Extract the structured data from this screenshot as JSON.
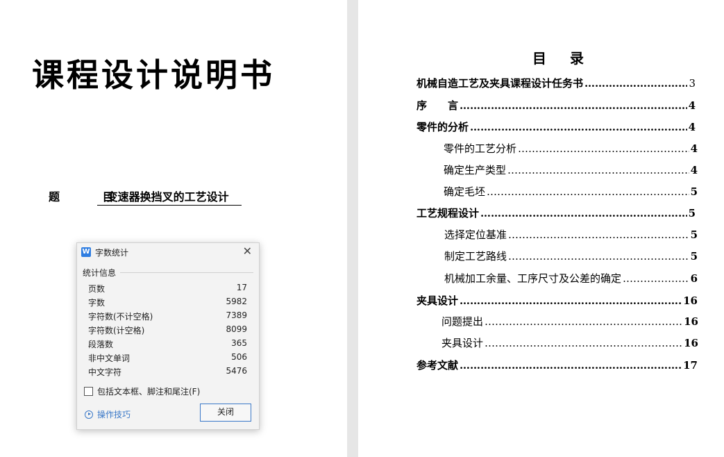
{
  "left_page": {
    "title": "课程设计说明书",
    "subject_label": "题 目",
    "subject_value": "变速器换挡叉的工艺设计"
  },
  "toc": {
    "title_a": "目",
    "title_b": "录",
    "entries": [
      {
        "text": "机械自造工艺及夹具课程设计任务书",
        "page": "3",
        "level": 1
      },
      {
        "text": "序　　言",
        "page": "4",
        "level": 1
      },
      {
        "text": "零件的分析",
        "page": "4",
        "level": 1
      },
      {
        "text": "零件的工艺分析",
        "page": "4",
        "level": 2
      },
      {
        "text": "确定生产类型",
        "page": "4",
        "level": 2
      },
      {
        "text": "确定毛坯",
        "page": "5",
        "level": 2
      },
      {
        "text": "工艺规程设计",
        "page": "5",
        "level": 1
      },
      {
        "text": "选择定位基准",
        "page": "5",
        "level": 2
      },
      {
        "text": "制定工艺路线",
        "page": "5",
        "level": 2
      },
      {
        "text": "机械加工余量、工序尺寸及公差的确定",
        "page": "6",
        "level": 2
      },
      {
        "text": "夹具设计",
        "page": "16",
        "level": 1
      },
      {
        "text": "问题提出",
        "page": "16",
        "level": 2
      },
      {
        "text": "夹具设计",
        "page": "16",
        "level": 2
      },
      {
        "text": "参考文献",
        "page": "17",
        "level": 1
      }
    ]
  },
  "dialog": {
    "app_icon": "W",
    "title": "字数统计",
    "section": "统计信息",
    "stats": [
      {
        "label": "页数",
        "value": "17"
      },
      {
        "label": "字数",
        "value": "5982"
      },
      {
        "label": "字符数(不计空格)",
        "value": "7389"
      },
      {
        "label": "字符数(计空格)",
        "value": "8099"
      },
      {
        "label": "段落数",
        "value": "365"
      },
      {
        "label": "非中文单词",
        "value": "506"
      },
      {
        "label": "中文字符",
        "value": "5476"
      }
    ],
    "checkbox_label": "包括文本框、脚注和尾注(F)",
    "checkbox_checked": false,
    "tips_label": "操作技巧",
    "close_label": "关闭",
    "accent_color": "#3a78c8"
  }
}
